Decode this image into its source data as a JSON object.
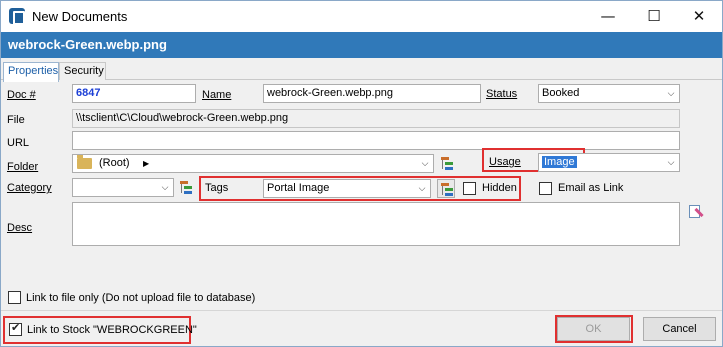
{
  "window": {
    "title": "New Documents",
    "min_glyph": "—",
    "max_glyph": "☐",
    "close_glyph": "✕"
  },
  "header": {
    "filename": "webrock-Green.webp.png"
  },
  "tabs": [
    {
      "label": "Properties",
      "active": true
    },
    {
      "label": "Security",
      "active": false
    }
  ],
  "form": {
    "doc_label": "Doc #",
    "doc_value": "6847",
    "name_label": "Name",
    "name_value": "webrock-Green.webp.png",
    "status_label": "Status",
    "status_value": "Booked",
    "file_label": "File",
    "file_value": "\\\\tsclient\\C\\Cloud\\webrock-Green.webp.png",
    "url_label": "URL",
    "url_value": "",
    "folder_label": "Folder",
    "folder_value": "(Root)",
    "usage_label": "Usage",
    "usage_value": "Image",
    "category_label": "Category",
    "category_value": "",
    "tags_label": "Tags",
    "tags_value": "Portal Image",
    "hidden_label": "Hidden",
    "hidden_checked": false,
    "email_link_label": "Email as Link",
    "email_link_checked": false,
    "desc_label": "Desc",
    "desc_value": "",
    "link_file_only_label": "Link to file only (Do not upload file to database)",
    "link_file_only_checked": false
  },
  "footer": {
    "link_stock_label": "Link to Stock \"WEBROCKGREEN\"",
    "link_stock_checked": true,
    "ok_label": "OK",
    "cancel_label": "Cancel"
  },
  "colors": {
    "header_blue": "#3079b9",
    "highlight_red": "#e03030",
    "doc_number_blue": "#1c3fd6"
  }
}
